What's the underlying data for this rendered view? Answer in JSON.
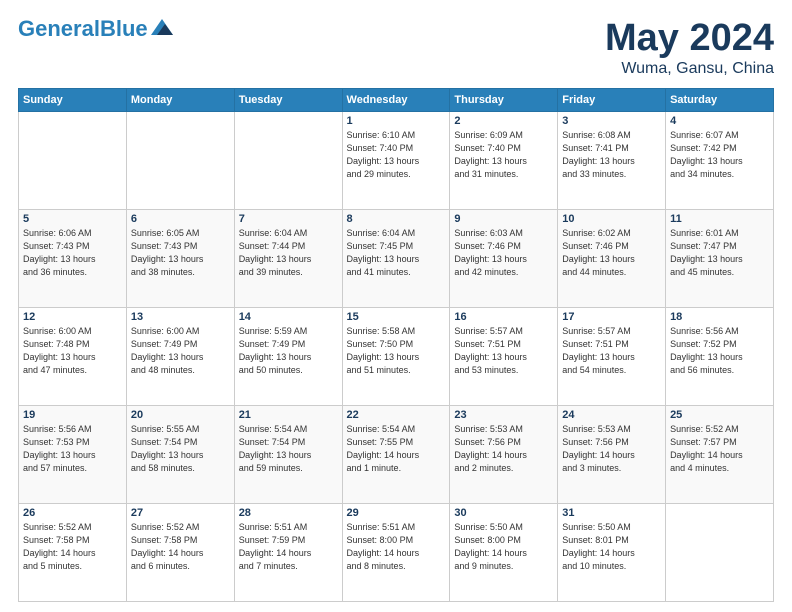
{
  "header": {
    "logo_line1": "General",
    "logo_line2": "Blue",
    "main_title": "May 2024",
    "subtitle": "Wuma, Gansu, China"
  },
  "weekdays": [
    "Sunday",
    "Monday",
    "Tuesday",
    "Wednesday",
    "Thursday",
    "Friday",
    "Saturday"
  ],
  "weeks": [
    [
      {
        "day": "",
        "info": ""
      },
      {
        "day": "",
        "info": ""
      },
      {
        "day": "",
        "info": ""
      },
      {
        "day": "1",
        "info": "Sunrise: 6:10 AM\nSunset: 7:40 PM\nDaylight: 13 hours\nand 29 minutes."
      },
      {
        "day": "2",
        "info": "Sunrise: 6:09 AM\nSunset: 7:40 PM\nDaylight: 13 hours\nand 31 minutes."
      },
      {
        "day": "3",
        "info": "Sunrise: 6:08 AM\nSunset: 7:41 PM\nDaylight: 13 hours\nand 33 minutes."
      },
      {
        "day": "4",
        "info": "Sunrise: 6:07 AM\nSunset: 7:42 PM\nDaylight: 13 hours\nand 34 minutes."
      }
    ],
    [
      {
        "day": "5",
        "info": "Sunrise: 6:06 AM\nSunset: 7:43 PM\nDaylight: 13 hours\nand 36 minutes."
      },
      {
        "day": "6",
        "info": "Sunrise: 6:05 AM\nSunset: 7:43 PM\nDaylight: 13 hours\nand 38 minutes."
      },
      {
        "day": "7",
        "info": "Sunrise: 6:04 AM\nSunset: 7:44 PM\nDaylight: 13 hours\nand 39 minutes."
      },
      {
        "day": "8",
        "info": "Sunrise: 6:04 AM\nSunset: 7:45 PM\nDaylight: 13 hours\nand 41 minutes."
      },
      {
        "day": "9",
        "info": "Sunrise: 6:03 AM\nSunset: 7:46 PM\nDaylight: 13 hours\nand 42 minutes."
      },
      {
        "day": "10",
        "info": "Sunrise: 6:02 AM\nSunset: 7:46 PM\nDaylight: 13 hours\nand 44 minutes."
      },
      {
        "day": "11",
        "info": "Sunrise: 6:01 AM\nSunset: 7:47 PM\nDaylight: 13 hours\nand 45 minutes."
      }
    ],
    [
      {
        "day": "12",
        "info": "Sunrise: 6:00 AM\nSunset: 7:48 PM\nDaylight: 13 hours\nand 47 minutes."
      },
      {
        "day": "13",
        "info": "Sunrise: 6:00 AM\nSunset: 7:49 PM\nDaylight: 13 hours\nand 48 minutes."
      },
      {
        "day": "14",
        "info": "Sunrise: 5:59 AM\nSunset: 7:49 PM\nDaylight: 13 hours\nand 50 minutes."
      },
      {
        "day": "15",
        "info": "Sunrise: 5:58 AM\nSunset: 7:50 PM\nDaylight: 13 hours\nand 51 minutes."
      },
      {
        "day": "16",
        "info": "Sunrise: 5:57 AM\nSunset: 7:51 PM\nDaylight: 13 hours\nand 53 minutes."
      },
      {
        "day": "17",
        "info": "Sunrise: 5:57 AM\nSunset: 7:51 PM\nDaylight: 13 hours\nand 54 minutes."
      },
      {
        "day": "18",
        "info": "Sunrise: 5:56 AM\nSunset: 7:52 PM\nDaylight: 13 hours\nand 56 minutes."
      }
    ],
    [
      {
        "day": "19",
        "info": "Sunrise: 5:56 AM\nSunset: 7:53 PM\nDaylight: 13 hours\nand 57 minutes."
      },
      {
        "day": "20",
        "info": "Sunrise: 5:55 AM\nSunset: 7:54 PM\nDaylight: 13 hours\nand 58 minutes."
      },
      {
        "day": "21",
        "info": "Sunrise: 5:54 AM\nSunset: 7:54 PM\nDaylight: 13 hours\nand 59 minutes."
      },
      {
        "day": "22",
        "info": "Sunrise: 5:54 AM\nSunset: 7:55 PM\nDaylight: 14 hours\nand 1 minute."
      },
      {
        "day": "23",
        "info": "Sunrise: 5:53 AM\nSunset: 7:56 PM\nDaylight: 14 hours\nand 2 minutes."
      },
      {
        "day": "24",
        "info": "Sunrise: 5:53 AM\nSunset: 7:56 PM\nDaylight: 14 hours\nand 3 minutes."
      },
      {
        "day": "25",
        "info": "Sunrise: 5:52 AM\nSunset: 7:57 PM\nDaylight: 14 hours\nand 4 minutes."
      }
    ],
    [
      {
        "day": "26",
        "info": "Sunrise: 5:52 AM\nSunset: 7:58 PM\nDaylight: 14 hours\nand 5 minutes."
      },
      {
        "day": "27",
        "info": "Sunrise: 5:52 AM\nSunset: 7:58 PM\nDaylight: 14 hours\nand 6 minutes."
      },
      {
        "day": "28",
        "info": "Sunrise: 5:51 AM\nSunset: 7:59 PM\nDaylight: 14 hours\nand 7 minutes."
      },
      {
        "day": "29",
        "info": "Sunrise: 5:51 AM\nSunset: 8:00 PM\nDaylight: 14 hours\nand 8 minutes."
      },
      {
        "day": "30",
        "info": "Sunrise: 5:50 AM\nSunset: 8:00 PM\nDaylight: 14 hours\nand 9 minutes."
      },
      {
        "day": "31",
        "info": "Sunrise: 5:50 AM\nSunset: 8:01 PM\nDaylight: 14 hours\nand 10 minutes."
      },
      {
        "day": "",
        "info": ""
      }
    ]
  ]
}
